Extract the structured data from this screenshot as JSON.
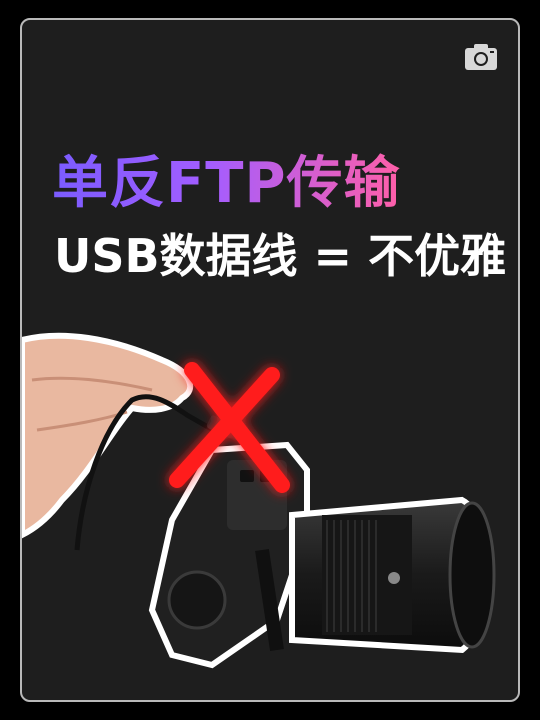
{
  "post": {
    "title_line1": "单反FTP传输",
    "title_line2": "USB数据线 = 不优雅"
  },
  "icons": {
    "top_right": "camera-icon"
  },
  "colors": {
    "background": "#1e1e1e",
    "border": "#b9b9b9",
    "title_gradient_start": "#7b5cff",
    "title_gradient_end": "#ff5fa8",
    "title2": "#ffffff",
    "cross": "#ff1f1f"
  }
}
